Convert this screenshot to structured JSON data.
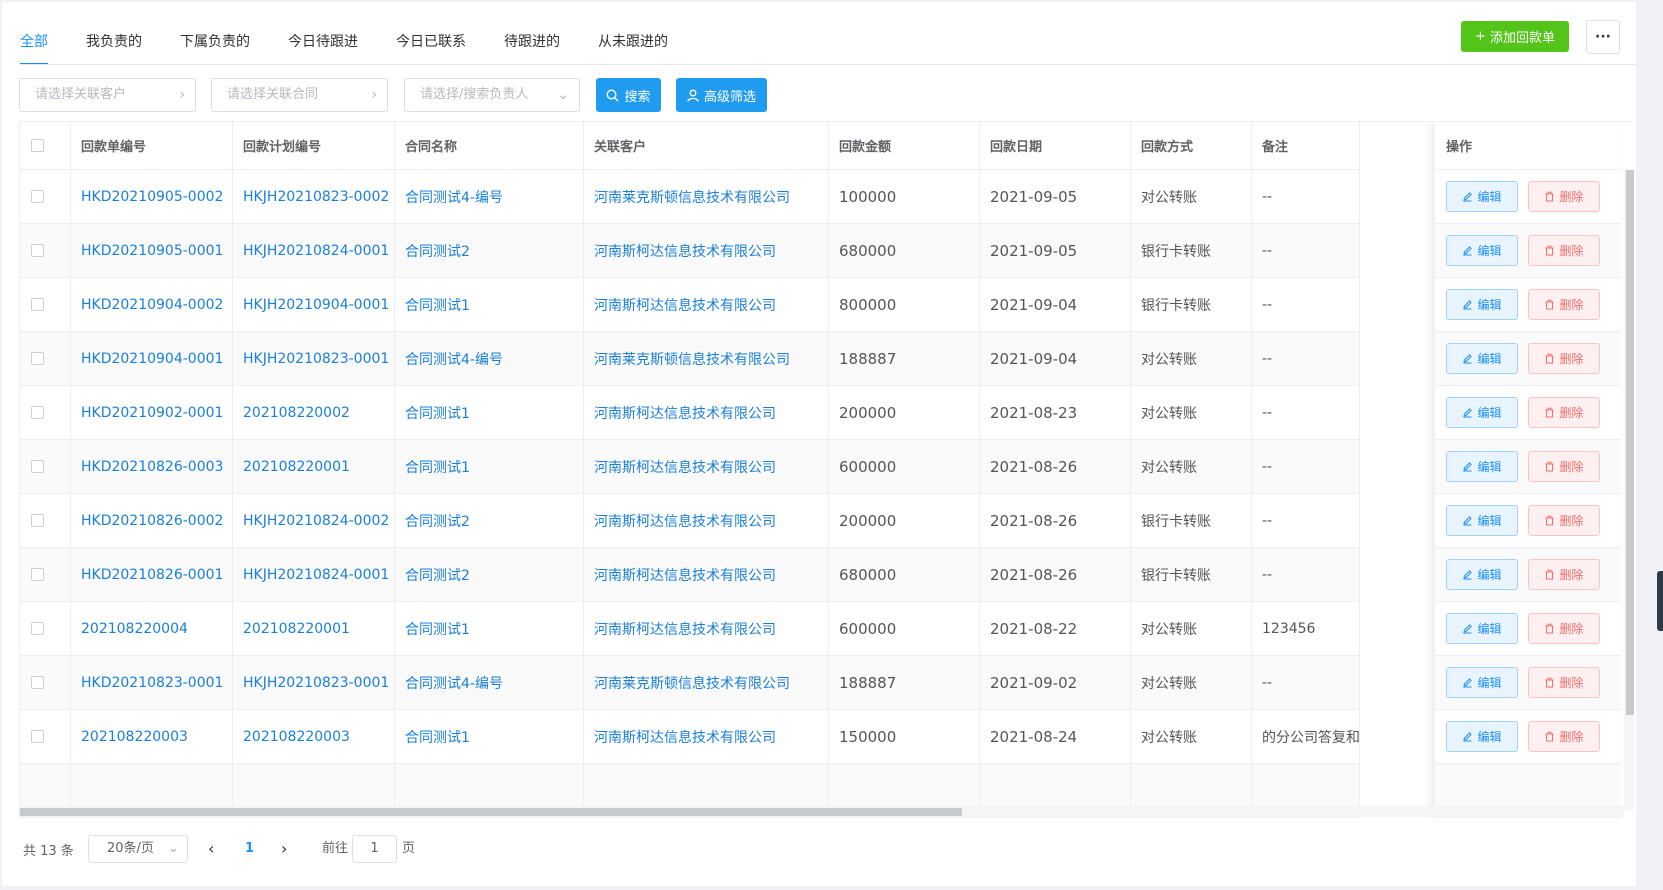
{
  "tabs": [
    {
      "label": "全部",
      "active": true
    },
    {
      "label": "我负责的",
      "active": false
    },
    {
      "label": "下属负责的",
      "active": false
    },
    {
      "label": "今日待跟进",
      "active": false
    },
    {
      "label": "今日已联系",
      "active": false
    },
    {
      "label": "待跟进的",
      "active": false
    },
    {
      "label": "从未跟进的",
      "active": false
    }
  ],
  "toolbar": {
    "add_label": "添加回款单",
    "more_label": "···"
  },
  "filters": {
    "customer_placeholder": "请选择关联客户",
    "contract_placeholder": "请选择关联合同",
    "owner_placeholder": "请选择/搜索负责人",
    "search_label": "搜索",
    "advanced_label": "高级筛选"
  },
  "table": {
    "headers": [
      "回款单编号",
      "回款计划编号",
      "合同名称",
      "关联客户",
      "回款金额",
      "回款日期",
      "回款方式",
      "备注",
      "操作"
    ],
    "edit_label": "编辑",
    "delete_label": "删除",
    "rows": [
      {
        "no": "HKD20210905-0002",
        "plan": "HKJH20210823-0002",
        "contract": "合同测试4-编号",
        "customer": "河南莱克斯顿信息技术有限公司",
        "amount": "100000",
        "date": "2021-09-05",
        "method": "对公转账",
        "note": "--"
      },
      {
        "no": "HKD20210905-0001",
        "plan": "HKJH20210824-0001",
        "contract": "合同测试2",
        "customer": "河南斯柯达信息技术有限公司",
        "amount": "680000",
        "date": "2021-09-05",
        "method": "银行卡转账",
        "note": "--"
      },
      {
        "no": "HKD20210904-0002",
        "plan": "HKJH20210904-0001",
        "contract": "合同测试1",
        "customer": "河南斯柯达信息技术有限公司",
        "amount": "800000",
        "date": "2021-09-04",
        "method": "银行卡转账",
        "note": "--"
      },
      {
        "no": "HKD20210904-0001",
        "plan": "HKJH20210823-0001",
        "contract": "合同测试4-编号",
        "customer": "河南莱克斯顿信息技术有限公司",
        "amount": "188887",
        "date": "2021-09-04",
        "method": "对公转账",
        "note": "--"
      },
      {
        "no": "HKD20210902-0001",
        "plan": "202108220002",
        "contract": "合同测试1",
        "customer": "河南斯柯达信息技术有限公司",
        "amount": "200000",
        "date": "2021-08-23",
        "method": "对公转账",
        "note": "--"
      },
      {
        "no": "HKD20210826-0003",
        "plan": "202108220001",
        "contract": "合同测试1",
        "customer": "河南斯柯达信息技术有限公司",
        "amount": "600000",
        "date": "2021-08-26",
        "method": "对公转账",
        "note": "--"
      },
      {
        "no": "HKD20210826-0002",
        "plan": "HKJH20210824-0002",
        "contract": "合同测试2",
        "customer": "河南斯柯达信息技术有限公司",
        "amount": "200000",
        "date": "2021-08-26",
        "method": "银行卡转账",
        "note": "--"
      },
      {
        "no": "HKD20210826-0001",
        "plan": "HKJH20210824-0001",
        "contract": "合同测试2",
        "customer": "河南斯柯达信息技术有限公司",
        "amount": "680000",
        "date": "2021-08-26",
        "method": "银行卡转账",
        "note": "--"
      },
      {
        "no": "202108220004",
        "plan": "202108220001",
        "contract": "合同测试1",
        "customer": "河南斯柯达信息技术有限公司",
        "amount": "600000",
        "date": "2021-08-22",
        "method": "对公转账",
        "note": "123456"
      },
      {
        "no": "HKD20210823-0001",
        "plan": "HKJH20210823-0001",
        "contract": "合同测试4-编号",
        "customer": "河南莱克斯顿信息技术有限公司",
        "amount": "188887",
        "date": "2021-09-02",
        "method": "对公转账",
        "note": "--"
      },
      {
        "no": "202108220003",
        "plan": "202108220003",
        "contract": "合同测试1",
        "customer": "河南斯柯达信息技术有限公司",
        "amount": "150000",
        "date": "2021-08-24",
        "method": "对公转账",
        "note": "的分公司答复和"
      }
    ]
  },
  "pagination": {
    "total": "共 13 条",
    "page_size": "20条/页",
    "current": "1",
    "goto_label": "前往",
    "goto_value": "1",
    "unit": "页"
  },
  "colors": {
    "accent": "#1890ff",
    "add": "#52c41a",
    "danger": "#f56c6c"
  }
}
